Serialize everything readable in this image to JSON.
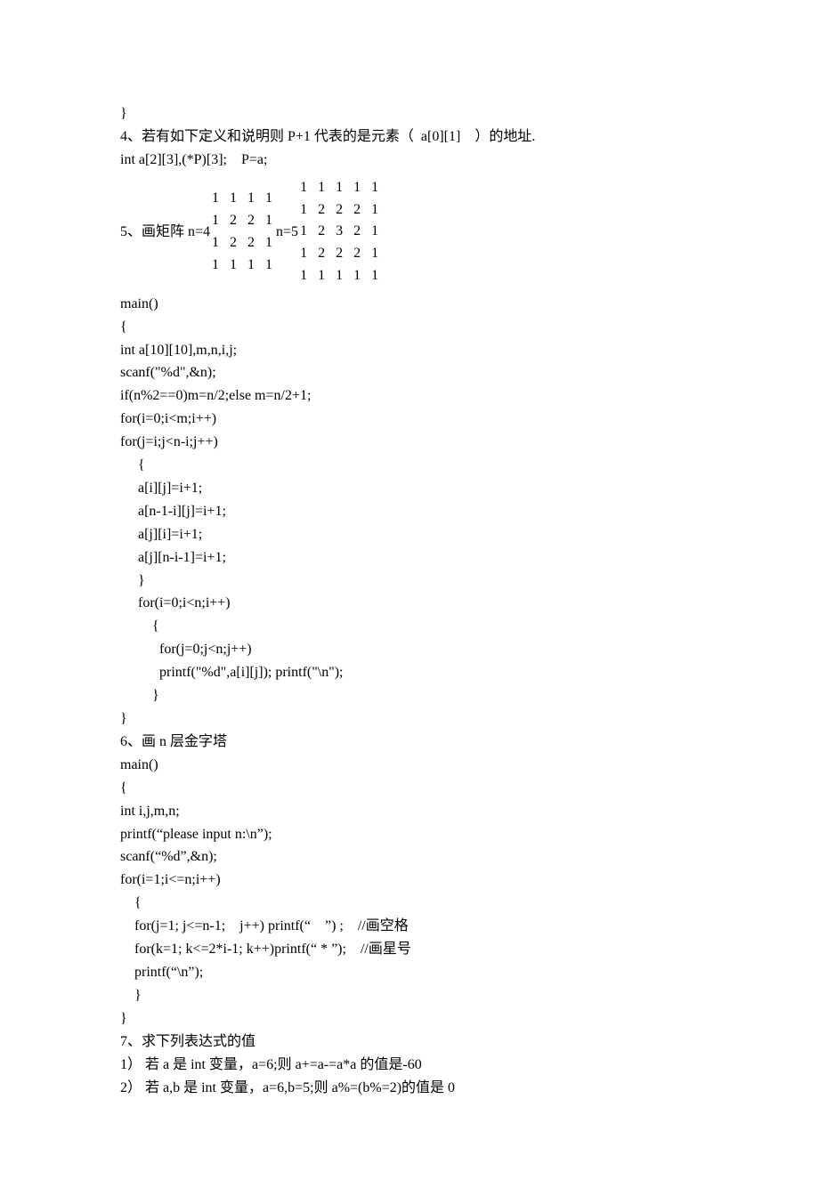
{
  "l_close1": "}",
  "q4_line1": "4、若有如下定义和说明则 P+1 代表的是元素（  a[0][1]    ）的地址.",
  "q4_line2": "int a[2][3],(*P)[3];    P=a;",
  "q5_label": "5、画矩阵 n=4",
  "m4": {
    "r0": "1   1   1   1",
    "r1": "1   2   2   1",
    "r2": "1   2   2   1",
    "r3": "1   1   1   1"
  },
  "q5_mid": "n=5",
  "m5": {
    "r0": "1   1   1   1   1",
    "r1": "1   2   2   2   1",
    "r2": "1   2   3   2   1",
    "r3": "1   2   2   2   1",
    "r4": "1   1   1   1   1"
  },
  "p5_main": "main()",
  "p5_open": "{",
  "p5_decl": "int a[10][10],m,n,i,j;",
  "p5_scan": "scanf(\"%d\",&n);",
  "p5_if": "if(n%2==0)m=n/2;else m=n/2+1;",
  "p5_for1": "for(i=0;i<m;i++)",
  "p5_for2": "for(j=i;j<n-i;j++)",
  "p5_b1_open": "     {",
  "p5_b1_l1": "     a[i][j]=i+1;",
  "p5_b1_l2": "     a[n-1-i][j]=i+1;",
  "p5_b1_l3": "     a[j][i]=i+1;",
  "p5_b1_l4": "     a[j][n-i-1]=i+1;",
  "p5_b1_close": "     }",
  "p5_for3": "     for(i=0;i<n;i++)",
  "p5_b2_open": "         {",
  "p5_for4": "           for(j=0;j<n;j++)",
  "p5_print": "           printf(\"%d\",a[i][j]); printf(\"\\n\");",
  "p5_b2_close": "         }",
  "p5_close": "}",
  "q6_title": "6、画 n 层金字塔",
  "p6_main": "main()",
  "p6_open": "{",
  "p6_decl": "int i,j,m,n;",
  "p6_print": "printf(“please input n:\\n”);",
  "p6_scan": "scanf(“%d”,&n);",
  "p6_for1": "for(i=1;i<=n;i++)",
  "p6_b_open": "    {",
  "p6_l1": "    for(j=1; j<=n-1;    j++) printf(“    ”) ;    //画空格",
  "p6_l2": "    for(k=1; k<=2*i-1; k++)printf(“ * ”);    //画星号",
  "p6_l3": "    printf(“\\n”);",
  "p6_b_close": "    }",
  "p6_close": "}",
  "q7_title": "7、求下列表达式的值",
  "q7_1": "1） 若 a 是 int 变量，a=6;则 a+=a-=a*a 的值是-60",
  "q7_2": "2） 若 a,b 是 int 变量，a=6,b=5;则 a%=(b%=2)的值是 0"
}
